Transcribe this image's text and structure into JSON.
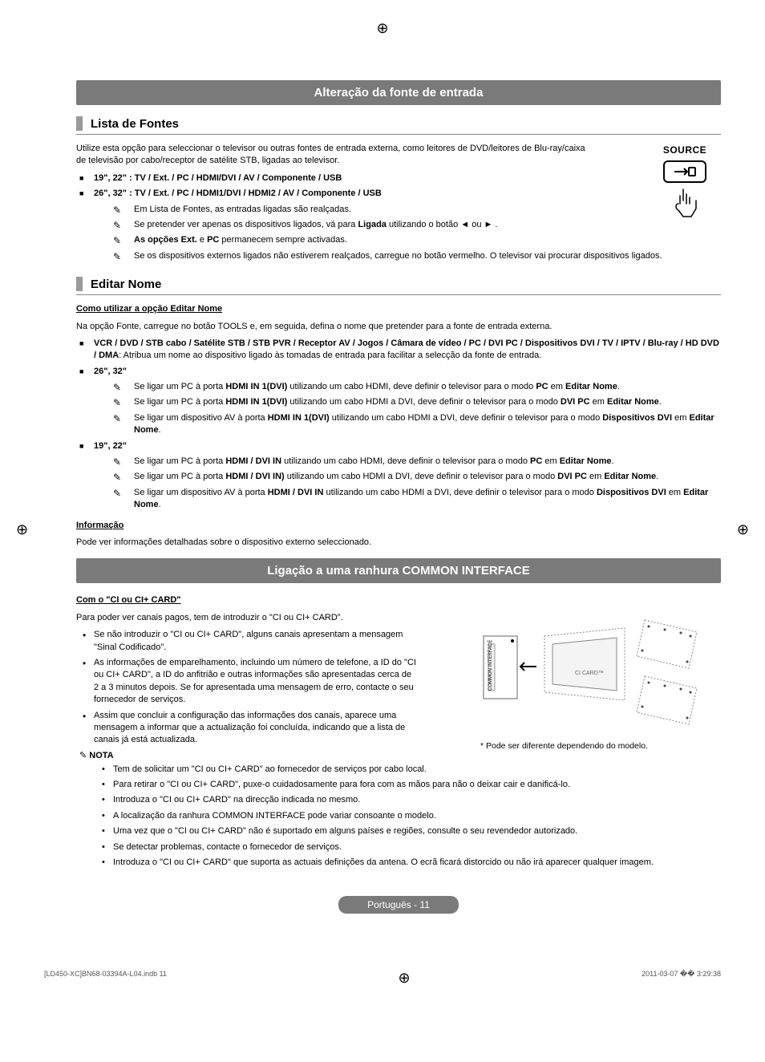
{
  "banner1": "Alteração da fonte de entrada",
  "section1": {
    "title": "Lista de Fontes",
    "intro": "Utilize esta opção para seleccionar o televisor ou outras fontes de entrada externa, como leitores de DVD/leitores de Blu-ray/caixa de televisão por cabo/receptor de satélite STB, ligadas ao televisor.",
    "model_1922_label": "19\", 22\" : TV / Ext. / PC / HDMI/DVI / AV / Componente / USB",
    "model_2632_label": "26\", 32\" : TV / Ext. / PC / HDMI1/DVI / HDMI2 / AV / Componente / USB",
    "notes": [
      "Em Lista de Fontes, as entradas ligadas são realçadas.",
      "Se pretender ver apenas os dispositivos ligados, vá para Ligada utilizando o botão ◄ ou ► .",
      "As opções Ext. e PC permanecem sempre activadas.",
      "Se os dispositivos externos ligados não estiverem realçados, carregue no botão vermelho. O televisor vai procurar dispositivos ligados."
    ]
  },
  "source_label": "SOURCE",
  "source_glyph": "⟶⊐",
  "section2": {
    "title": "Editar Nome",
    "subhead1": "Como utilizar a opção Editar Nome",
    "intro": "Na opção Fonte, carregue no botão TOOLS e, em seguida, defina o nome que pretender para a fonte de entrada externa.",
    "bullet_devices_prefix": "VCR / DVD / STB cabo / Satélite STB / STB PVR / Receptor AV / Jogos / Câmara de vídeo / PC / DVI PC / Dispositivos DVI / TV / IPTV / Blu-ray / HD DVD / DMA",
    "bullet_devices_rest": ": Atribua um nome ao dispositivo ligado às tomadas de entrada para facilitar a selecção da fonte de entrada.",
    "group_2632_label": "26\", 32\"",
    "notes_2632": [
      {
        "pre": "Se ligar um PC à porta ",
        "b1": "HDMI IN 1(DVI)",
        "mid": " utilizando um cabo HDMI, deve definir o televisor para o modo ",
        "b2": "PC",
        "mid2": " em ",
        "b3": "Editar Nome",
        "end": "."
      },
      {
        "pre": "Se ligar um PC à porta ",
        "b1": "HDMI IN 1(DVI)",
        "mid": " utilizando um cabo HDMI a DVI, deve definir o televisor para o modo ",
        "b2": "DVI PC",
        "mid2": " em ",
        "b3": "Editar Nome",
        "end": "."
      },
      {
        "pre": "Se ligar um dispositivo AV à porta ",
        "b1": "HDMI IN 1(DVI)",
        "mid": " utilizando um cabo HDMI a DVI, deve definir o televisor para o modo ",
        "b2": "Dispositivos DVI",
        "mid2": " em ",
        "b3": "Editar Nome",
        "end": "."
      }
    ],
    "group_1922_label": "19\", 22\"",
    "notes_1922": [
      {
        "pre": "Se ligar um PC à porta ",
        "b1": "HDMI / DVI IN",
        "mid": " utilizando um cabo HDMI, deve definir o televisor para o modo ",
        "b2": "PC",
        "mid2": " em ",
        "b3": "Editar Nome",
        "end": "."
      },
      {
        "pre": "Se ligar um PC à porta ",
        "b1": "HDMI / DVI IN)",
        "mid": " utilizando um cabo HDMI a DVI, deve definir o televisor para o modo ",
        "b2": "DVI PC",
        "mid2": " em ",
        "b3": "Editar Nome",
        "end": "."
      },
      {
        "pre": "Se ligar um dispositivo AV à porta ",
        "b1": "HDMI / DVI IN",
        "mid": " utilizando um cabo HDMI a DVI, deve definir o televisor para o modo ",
        "b2": "Dispositivos DVI",
        "mid2": " em ",
        "b3": "Editar Nome",
        "end": "."
      }
    ],
    "subhead2": "Informação",
    "info_text": "Pode ver informações detalhadas sobre o dispositivo externo seleccionado."
  },
  "banner2": "Ligação a uma ranhura COMMON INTERFACE",
  "section3": {
    "subhead": "Com o \"CI ou CI+ CARD\"",
    "intro": "Para poder ver canais pagos, tem de introduzir o \"CI ou CI+ CARD\".",
    "bullets": [
      "Se não introduzir o \"CI ou CI+ CARD\", alguns canais apresentam a mensagem \"Sinal Codificado\".",
      "As informações de emparelhamento, incluindo um número de telefone, a ID do \"CI ou CI+ CARD\", a ID do anfitrião e outras informações são apresentadas cerca de 2 a 3 minutos depois. Se for apresentada uma mensagem de erro, contacte o seu fornecedor de serviços.",
      "Assim que concluir a configuração das informações dos canais, aparece uma mensagem a informar que a actualização foi concluída, indicando que a lista de canais já está actualizada."
    ],
    "fig_caption": "* Pode ser diferente dependendo do modelo.",
    "fig_slot_label": "COMMON INTERFACE",
    "fig_card_label": "CI CARD™",
    "nota_label": "NOTA",
    "nota": [
      "Tem de solicitar um \"CI ou CI+ CARD\" ao fornecedor de serviços por cabo local.",
      "Para retirar o \"CI ou CI+ CARD\", puxe-o cuidadosamente para fora com as mãos para não o deixar cair e danificá-lo.",
      "Introduza o \"CI ou CI+ CARD\" na direcção indicada no mesmo.",
      "A localização da ranhura COMMON INTERFACE pode variar consoante o modelo.",
      "Uma vez que o \"CI ou CI+ CARD\" não é suportado em alguns países e regiões, consulte o seu revendedor autorizado.",
      "Se detectar problemas, contacte o fornecedor de serviços.",
      "Introduza o \"CI ou CI+ CARD\" que suporta as actuais definições da antena. O ecrã ficará distorcido ou não irá aparecer qualquer imagem."
    ]
  },
  "page_label": "Português - 11",
  "footer": {
    "left": "[LD450-XC]BN68-03394A-L04.indb   11",
    "right": "2011-03-07   �� 3:29:38"
  }
}
